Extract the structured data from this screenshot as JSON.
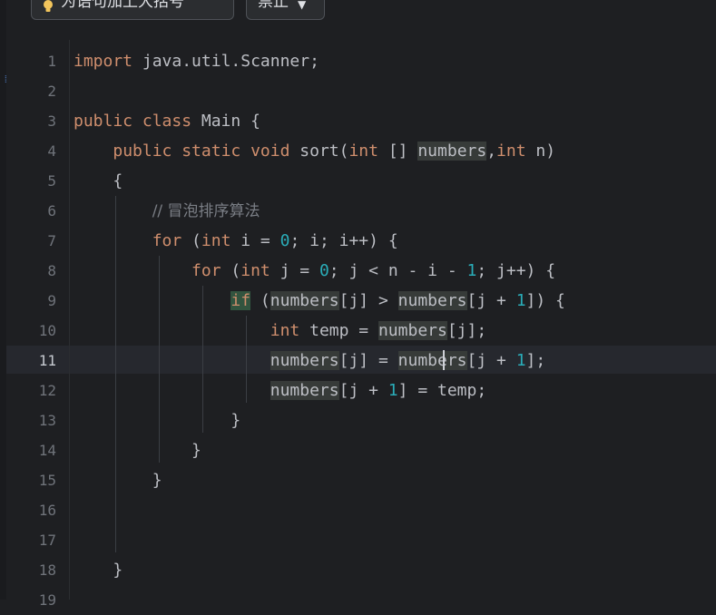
{
  "toolbar": {
    "intention_label": "为语句加上大括号",
    "dropdown_value": "禁止"
  },
  "editor": {
    "current_line": 11,
    "line_numbers": [
      "1",
      "2",
      "3",
      "4",
      "5",
      "6",
      "7",
      "8",
      "9",
      "10",
      "11",
      "12",
      "13",
      "14",
      "15",
      "16",
      "17",
      "18",
      "19"
    ],
    "code": {
      "l1_kw": "import",
      "l1_rest": " java.util.Scanner;",
      "l3_kw": "public class",
      "l3_rest": " Main {",
      "l4_kw1": "public static void",
      "l4_a": " sort(",
      "l4_kw2": "int",
      "l4_b": " [] ",
      "l4_c": "numbers",
      "l4_d": ",",
      "l4_kw3": "int",
      "l4_e": " n)",
      "l5": "{",
      "l6_comment": "// 冒泡排序算法",
      "l7_kw": "for",
      "l7_a": " (",
      "l7_kw2": "int",
      "l7_b": " i = ",
      "l7_n": "0",
      "l7_c": "; i; i++) {",
      "l8_kw": "for",
      "l8_a": " (",
      "l8_kw2": "int",
      "l8_b": " j = ",
      "l8_n0": "0",
      "l8_c": "; j < n - i - ",
      "l8_n1": "1",
      "l8_d": "; j++) {",
      "l9_kw": "if",
      "l9_a": " (",
      "l9_v1": "numbers",
      "l9_b": "[j] > ",
      "l9_v2": "numbers",
      "l9_c": "[j + ",
      "l9_n": "1",
      "l9_d": "]) {",
      "l10_kw": "int",
      "l10_a": " temp = ",
      "l10_v": "numbers",
      "l10_b": "[j];",
      "l11_v1": "numbers",
      "l11_a": "[j] = ",
      "l11_v2": "numbers",
      "l11_b": "[j + ",
      "l11_n": "1",
      "l11_c": "];",
      "l12_v": "numbers",
      "l12_a": "[j + ",
      "l12_n": "1",
      "l12_b": "] = temp;",
      "l13": "}",
      "l14": "}",
      "l15": "}",
      "l18": "}"
    }
  },
  "colors": {
    "background": "#1e1f22",
    "keyword": "#cf8e6d",
    "number": "#2aacb8",
    "text": "#bcbec4",
    "comment": "#7a7e85"
  },
  "icons": [
    "lightbulb-icon",
    "chevron-down-icon"
  ]
}
